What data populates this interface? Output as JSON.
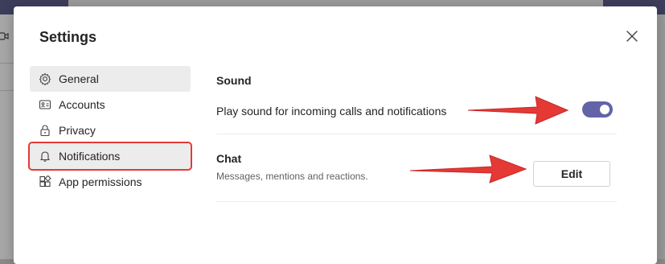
{
  "dialog": {
    "title": "Settings",
    "close_icon": "close-icon"
  },
  "nav": {
    "items": [
      {
        "label": "General",
        "icon": "gear-icon",
        "selected": true
      },
      {
        "label": "Accounts",
        "icon": "id-card-icon"
      },
      {
        "label": "Privacy",
        "icon": "lock-icon"
      },
      {
        "label": "Notifications",
        "icon": "bell-icon",
        "annotated": true
      },
      {
        "label": "App permissions",
        "icon": "app-grid-icon"
      }
    ]
  },
  "sound": {
    "title": "Sound",
    "play_sound_label": "Play sound for incoming calls and notifications",
    "toggle_on": true
  },
  "chat": {
    "title": "Chat",
    "subtitle": "Messages, mentions and reactions.",
    "edit_label": "Edit"
  },
  "colors": {
    "accent": "#6264a7",
    "annotation": "#e53935"
  }
}
